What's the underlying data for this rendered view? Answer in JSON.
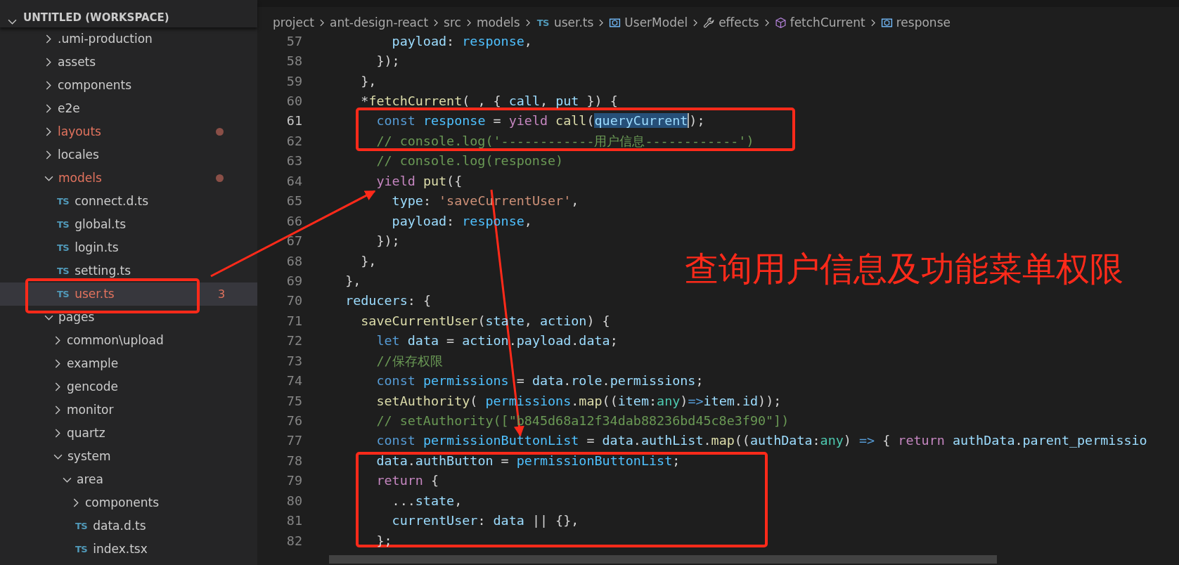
{
  "explorer": {
    "title": "UNTITLED (WORKSPACE)",
    "items": [
      {
        "kind": "folder",
        "label": ".umi-production",
        "expanded": false,
        "modified": false
      },
      {
        "kind": "folder",
        "label": "assets",
        "expanded": false,
        "modified": false
      },
      {
        "kind": "folder",
        "label": "components",
        "expanded": false,
        "modified": false
      },
      {
        "kind": "folder",
        "label": "e2e",
        "expanded": false,
        "modified": false
      },
      {
        "kind": "folder",
        "label": "layouts",
        "expanded": false,
        "modified": true
      },
      {
        "kind": "folder",
        "label": "locales",
        "expanded": false,
        "modified": false
      },
      {
        "kind": "folder",
        "label": "models",
        "expanded": true,
        "modified": true,
        "children": [
          {
            "kind": "file",
            "icon": "TS",
            "label": "connect.d.ts",
            "modified": false,
            "selected": false
          },
          {
            "kind": "file",
            "icon": "TS",
            "label": "global.ts",
            "modified": false,
            "selected": false
          },
          {
            "kind": "file",
            "icon": "TS",
            "label": "login.ts",
            "modified": false,
            "selected": false
          },
          {
            "kind": "file",
            "icon": "TS",
            "label": "setting.ts",
            "modified": false,
            "selected": false
          },
          {
            "kind": "file",
            "icon": "TS",
            "label": "user.ts",
            "modified": true,
            "badge": "3",
            "selected": true
          }
        ]
      },
      {
        "kind": "folder",
        "label": "pages",
        "expanded": true,
        "modified": false,
        "children": [
          {
            "kind": "folder",
            "label": "common\\upload",
            "expanded": false,
            "modified": false
          },
          {
            "kind": "folder",
            "label": "example",
            "expanded": false,
            "modified": false
          },
          {
            "kind": "folder",
            "label": "gencode",
            "expanded": false,
            "modified": false
          },
          {
            "kind": "folder",
            "label": "monitor",
            "expanded": false,
            "modified": false
          },
          {
            "kind": "folder",
            "label": "quartz",
            "expanded": false,
            "modified": false
          },
          {
            "kind": "folder",
            "label": "system",
            "expanded": true,
            "modified": false,
            "children": [
              {
                "kind": "folder",
                "label": "area",
                "expanded": true,
                "modified": false,
                "children": [
                  {
                    "kind": "folder",
                    "label": "components",
                    "expanded": false,
                    "modified": false
                  },
                  {
                    "kind": "file",
                    "icon": "TS",
                    "label": "data.d.ts",
                    "modified": false,
                    "selected": false
                  },
                  {
                    "kind": "file",
                    "icon": "TS",
                    "label": "index.tsx",
                    "modified": false,
                    "selected": false
                  }
                ]
              }
            ]
          }
        ]
      }
    ]
  },
  "breadcrumb": [
    {
      "kind": "plain",
      "label": "project"
    },
    {
      "kind": "plain",
      "label": "ant-design-react"
    },
    {
      "kind": "plain",
      "label": "src"
    },
    {
      "kind": "plain",
      "label": "models"
    },
    {
      "kind": "file",
      "icon": "TS",
      "label": "user.ts"
    },
    {
      "kind": "symbol",
      "label": "UserModel"
    },
    {
      "kind": "wrench",
      "label": "effects"
    },
    {
      "kind": "cube",
      "label": "fetchCurrent"
    },
    {
      "kind": "symbol",
      "label": "response"
    }
  ],
  "code": [
    {
      "number": "57",
      "current": false,
      "tokens": [
        {
          "kind": "v",
          "text": "        payload"
        },
        {
          "kind": "p",
          "text": ": "
        },
        {
          "kind": "cn",
          "text": "response"
        },
        {
          "kind": "p",
          "text": ","
        }
      ]
    },
    {
      "number": "58",
      "current": false,
      "tokens": [
        {
          "kind": "p",
          "text": "      });"
        }
      ]
    },
    {
      "number": "59",
      "current": false,
      "tokens": [
        {
          "kind": "p",
          "text": "    },"
        }
      ]
    },
    {
      "number": "60",
      "current": false,
      "tokens": [
        {
          "kind": "p",
          "text": "    *"
        },
        {
          "kind": "f",
          "text": "fetchCurrent"
        },
        {
          "kind": "p",
          "text": "( , { "
        },
        {
          "kind": "v",
          "text": "call"
        },
        {
          "kind": "p",
          "text": ", "
        },
        {
          "kind": "v",
          "text": "put"
        },
        {
          "kind": "p",
          "text": " }) {"
        }
      ]
    },
    {
      "number": "61",
      "current": true,
      "tokens": [
        {
          "kind": "k",
          "text": "      const "
        },
        {
          "kind": "cn",
          "text": "response"
        },
        {
          "kind": "p",
          "text": " = "
        },
        {
          "kind": "c",
          "text": "yield "
        },
        {
          "kind": "f",
          "text": "call"
        },
        {
          "kind": "p",
          "text": "("
        },
        {
          "kind": "vs",
          "text": "queryCurrent"
        },
        {
          "kind": "p",
          "text": ");"
        }
      ]
    },
    {
      "number": "62",
      "current": false,
      "tokens": [
        {
          "kind": "m",
          "text": "      // console.log('------------用户信息------------')"
        }
      ]
    },
    {
      "number": "63",
      "current": false,
      "tokens": [
        {
          "kind": "m",
          "text": "      // console.log(response)"
        }
      ]
    },
    {
      "number": "64",
      "current": false,
      "tokens": [
        {
          "kind": "c",
          "text": "      yield "
        },
        {
          "kind": "f",
          "text": "put"
        },
        {
          "kind": "p",
          "text": "({"
        }
      ]
    },
    {
      "number": "65",
      "current": false,
      "tokens": [
        {
          "kind": "v",
          "text": "        type"
        },
        {
          "kind": "p",
          "text": ": "
        },
        {
          "kind": "s",
          "text": "'saveCurrentUser'"
        },
        {
          "kind": "p",
          "text": ","
        }
      ]
    },
    {
      "number": "66",
      "current": false,
      "tokens": [
        {
          "kind": "v",
          "text": "        payload"
        },
        {
          "kind": "p",
          "text": ": "
        },
        {
          "kind": "cn",
          "text": "response"
        },
        {
          "kind": "p",
          "text": ","
        }
      ]
    },
    {
      "number": "67",
      "current": false,
      "tokens": [
        {
          "kind": "p",
          "text": "      });"
        }
      ]
    },
    {
      "number": "68",
      "current": false,
      "tokens": [
        {
          "kind": "p",
          "text": "    },"
        }
      ]
    },
    {
      "number": "69",
      "current": false,
      "tokens": [
        {
          "kind": "p",
          "text": "  },"
        }
      ]
    },
    {
      "number": "70",
      "current": false,
      "tokens": [
        {
          "kind": "v",
          "text": "  reducers"
        },
        {
          "kind": "p",
          "text": ": {"
        }
      ]
    },
    {
      "number": "71",
      "current": false,
      "tokens": [
        {
          "kind": "f",
          "text": "    saveCurrentUser"
        },
        {
          "kind": "p",
          "text": "("
        },
        {
          "kind": "v",
          "text": "state"
        },
        {
          "kind": "p",
          "text": ", "
        },
        {
          "kind": "v",
          "text": "action"
        },
        {
          "kind": "p",
          "text": ") {"
        }
      ]
    },
    {
      "number": "72",
      "current": false,
      "tokens": [
        {
          "kind": "k",
          "text": "      let "
        },
        {
          "kind": "v",
          "text": "data"
        },
        {
          "kind": "p",
          "text": " = "
        },
        {
          "kind": "v",
          "text": "action"
        },
        {
          "kind": "p",
          "text": "."
        },
        {
          "kind": "v",
          "text": "payload"
        },
        {
          "kind": "p",
          "text": "."
        },
        {
          "kind": "v",
          "text": "data"
        },
        {
          "kind": "p",
          "text": ";"
        }
      ]
    },
    {
      "number": "73",
      "current": false,
      "tokens": [
        {
          "kind": "m",
          "text": "      //保存权限"
        }
      ]
    },
    {
      "number": "74",
      "current": false,
      "tokens": [
        {
          "kind": "k",
          "text": "      const "
        },
        {
          "kind": "cn",
          "text": "permissions"
        },
        {
          "kind": "p",
          "text": " = "
        },
        {
          "kind": "v",
          "text": "data"
        },
        {
          "kind": "p",
          "text": "."
        },
        {
          "kind": "v",
          "text": "role"
        },
        {
          "kind": "p",
          "text": "."
        },
        {
          "kind": "v",
          "text": "permissions"
        },
        {
          "kind": "p",
          "text": ";"
        }
      ]
    },
    {
      "number": "75",
      "current": false,
      "tokens": [
        {
          "kind": "f",
          "text": "      setAuthority"
        },
        {
          "kind": "p",
          "text": "( "
        },
        {
          "kind": "cn",
          "text": "permissions"
        },
        {
          "kind": "p",
          "text": "."
        },
        {
          "kind": "f",
          "text": "map"
        },
        {
          "kind": "p",
          "text": "(("
        },
        {
          "kind": "v",
          "text": "item"
        },
        {
          "kind": "p",
          "text": ":"
        },
        {
          "kind": "t",
          "text": "any"
        },
        {
          "kind": "p",
          "text": ")"
        },
        {
          "kind": "k",
          "text": "=>"
        },
        {
          "kind": "v",
          "text": "item"
        },
        {
          "kind": "p",
          "text": "."
        },
        {
          "kind": "v",
          "text": "id"
        },
        {
          "kind": "p",
          "text": "));"
        }
      ]
    },
    {
      "number": "76",
      "current": false,
      "tokens": [
        {
          "kind": "m",
          "text": "      // setAuthority([\"b845d68a12f34dab88236bd45c8e3f90\"])"
        }
      ]
    },
    {
      "number": "77",
      "current": false,
      "tokens": [
        {
          "kind": "k",
          "text": "      const "
        },
        {
          "kind": "cn",
          "text": "permissionButtonList"
        },
        {
          "kind": "p",
          "text": " = "
        },
        {
          "kind": "v",
          "text": "data"
        },
        {
          "kind": "p",
          "text": "."
        },
        {
          "kind": "v",
          "text": "authList"
        },
        {
          "kind": "p",
          "text": "."
        },
        {
          "kind": "f",
          "text": "map"
        },
        {
          "kind": "p",
          "text": "(("
        },
        {
          "kind": "v",
          "text": "authData"
        },
        {
          "kind": "p",
          "text": ":"
        },
        {
          "kind": "t",
          "text": "any"
        },
        {
          "kind": "p",
          "text": ") "
        },
        {
          "kind": "k",
          "text": "=>"
        },
        {
          "kind": "p",
          "text": " { "
        },
        {
          "kind": "c",
          "text": "return "
        },
        {
          "kind": "v",
          "text": "authData"
        },
        {
          "kind": "p",
          "text": "."
        },
        {
          "kind": "v",
          "text": "parent_permissio"
        }
      ]
    },
    {
      "number": "78",
      "current": false,
      "tokens": [
        {
          "kind": "v",
          "text": "      data"
        },
        {
          "kind": "p",
          "text": "."
        },
        {
          "kind": "v",
          "text": "authButton"
        },
        {
          "kind": "p",
          "text": " = "
        },
        {
          "kind": "cn",
          "text": "permissionButtonList"
        },
        {
          "kind": "p",
          "text": ";"
        }
      ]
    },
    {
      "number": "79",
      "current": false,
      "tokens": [
        {
          "kind": "c",
          "text": "      return"
        },
        {
          "kind": "p",
          "text": " {"
        }
      ]
    },
    {
      "number": "80",
      "current": false,
      "tokens": [
        {
          "kind": "p",
          "text": "        ..."
        },
        {
          "kind": "v",
          "text": "state"
        },
        {
          "kind": "p",
          "text": ","
        }
      ]
    },
    {
      "number": "81",
      "current": false,
      "tokens": [
        {
          "kind": "v",
          "text": "        currentUser"
        },
        {
          "kind": "p",
          "text": ": "
        },
        {
          "kind": "v",
          "text": "data"
        },
        {
          "kind": "p",
          "text": " || {},"
        }
      ]
    },
    {
      "number": "82",
      "current": false,
      "tokens": [
        {
          "kind": "p",
          "text": "      };"
        }
      ]
    }
  ],
  "annotation": {
    "note": "查询用户信息及功能菜单权限"
  }
}
